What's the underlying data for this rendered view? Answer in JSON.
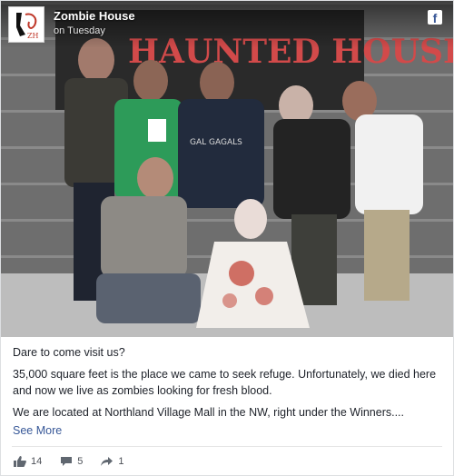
{
  "post": {
    "page_name": "Zombie House",
    "time": "on Tuesday",
    "logo_text": "ZH",
    "photo_text": "HAUNTED HOUSE",
    "shirt_text": "GAL GAGALS",
    "paragraphs": [
      "Dare to come visit us?",
      "35,000 square feet is the place we came to seek refuge. Unfortunately, we died here and now we live as zombies looking for fresh blood.",
      "We are located at Northland Village Mall in the NW, right under the Winners...."
    ],
    "see_more": "See More"
  },
  "reactions": {
    "likes": "14",
    "comments": "5",
    "shares": "1"
  },
  "colors": {
    "link": "#385898",
    "text": "#1d2129",
    "muted": "#4b4f56",
    "facebook": "#3b5998"
  },
  "icons": [
    "facebook-icon",
    "thumbs-up-icon",
    "comment-icon",
    "share-icon"
  ]
}
